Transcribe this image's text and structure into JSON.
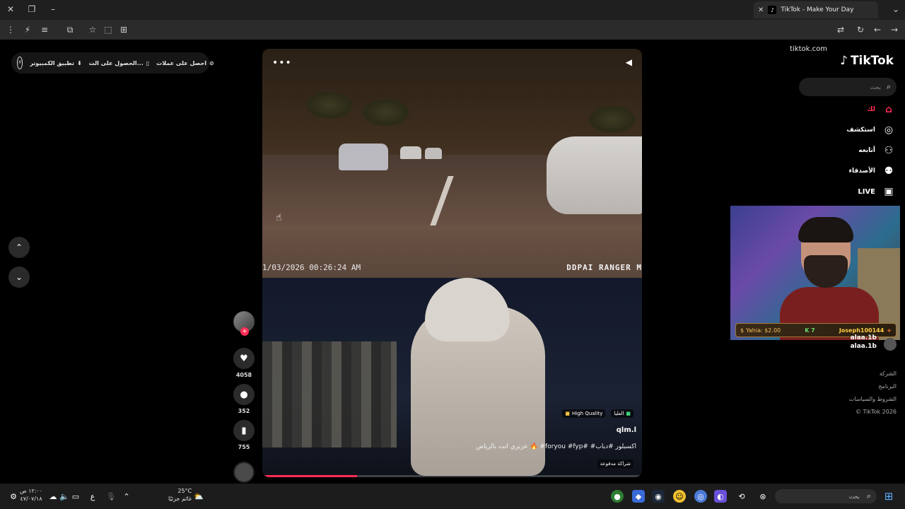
{
  "browser": {
    "tab_title": "TikTok - Make Your Day",
    "url": "tiktok.com",
    "tab_close": "✕",
    "new_tab": "+"
  },
  "promo": {
    "item1": "احصل على عملات",
    "item2": "الحصول على الت...",
    "item3": "تطبيق الكمبيوتر"
  },
  "video": {
    "timestamp": "1/03/2026 00:26:24 AM",
    "brand": "DDPAI RANGER M",
    "badge_top": "العليا",
    "badge_quality": "High Quality",
    "author": "qlm.l",
    "description": "عزيزي انت بالرياض 🔥 #foryou #fyp# #اكسبلور #دباب",
    "paid": "شراكة مدفوعة",
    "progress": 0.25
  },
  "actions": {
    "likes": "4058",
    "comments": "352",
    "saves": "755"
  },
  "sidebar": {
    "brand": "TikTok",
    "search_placeholder": "بحث",
    "items": [
      {
        "label": "لك",
        "icon": "home-icon",
        "color": "#fe2c55"
      },
      {
        "label": "استكشف",
        "icon": "compass-icon"
      },
      {
        "label": "أتابعه",
        "icon": "following-icon"
      },
      {
        "label": "الأصدقاء",
        "icon": "friends-icon"
      },
      {
        "label": "LIVE",
        "icon": "live-icon"
      }
    ],
    "follow_name": "alaa.1b",
    "follow_handle": "alaa.1b",
    "footer": [
      "الشركة",
      "البرنامج",
      "الشروط والسياسات",
      "© TikTok 2026"
    ]
  },
  "stream_overlay": {
    "donation": "Yahia: $2.00",
    "count": "7",
    "user": "Joseph100144"
  },
  "taskbar": {
    "time": "١٢:٠٠ ص",
    "date": "٤٧/٠٧/١٨",
    "lang": "ع",
    "temp": "25°C",
    "weather": "غائم جزئيًا",
    "search": "بحث"
  }
}
